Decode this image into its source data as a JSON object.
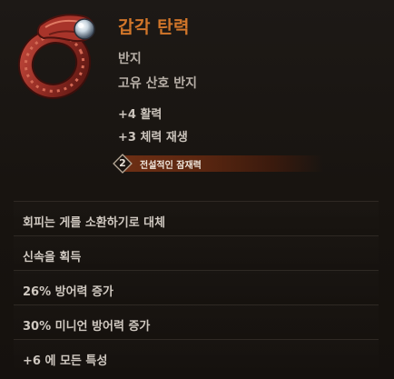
{
  "item": {
    "name": "갑각 탄력",
    "type": "반지",
    "subtype": "고유 산호 반지",
    "icon": "coral-ring-icon"
  },
  "stats": [
    "+4 활력",
    "+3 체력 재생"
  ],
  "potential": {
    "level": "2",
    "label": "전설적인 잠재력"
  },
  "affixes": [
    "회피는 게를 소환하기로 대체",
    "신속을 획득",
    "26% 방어력 증가",
    "30% 미니언 방어력 증가",
    "+6 에 모든 특성"
  ],
  "colors": {
    "name": "#d2762a",
    "potential_bar": "#6e2f14",
    "text": "#cfc8c0"
  }
}
